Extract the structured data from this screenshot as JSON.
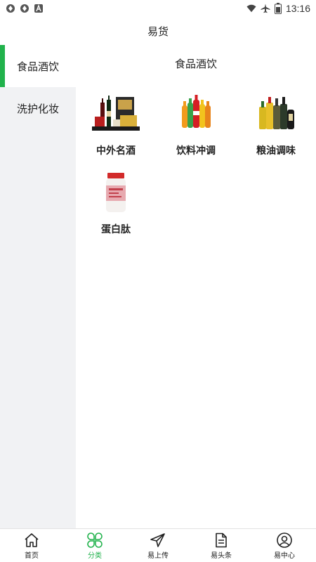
{
  "status_bar": {
    "time": "13:16",
    "left_icons": [
      "sync-icon",
      "sync-icon",
      "text-a-icon"
    ],
    "right_icons": [
      "wifi-icon",
      "airplane-icon",
      "battery-icon"
    ]
  },
  "header": {
    "title": "易货"
  },
  "sidebar": {
    "items": [
      {
        "label": "食品酒饮",
        "active": true
      },
      {
        "label": "洗护化妆",
        "active": false
      }
    ]
  },
  "main": {
    "section_title": "食品酒饮",
    "categories": [
      {
        "label": "中外名酒",
        "icon": "wine-products-image"
      },
      {
        "label": "饮料冲调",
        "icon": "beverage-bottles-image"
      },
      {
        "label": "粮油调味",
        "icon": "oil-bottles-image"
      },
      {
        "label": "蛋白肽",
        "icon": "protein-jar-image"
      }
    ]
  },
  "bottom_nav": {
    "items": [
      {
        "label": "首页",
        "icon": "home-icon",
        "active": false
      },
      {
        "label": "分类",
        "icon": "category-clover-icon",
        "active": true
      },
      {
        "label": "易上传",
        "icon": "paper-plane-icon",
        "active": false
      },
      {
        "label": "易头条",
        "icon": "document-icon",
        "active": false
      },
      {
        "label": "易中心",
        "icon": "user-circle-icon",
        "active": false
      }
    ]
  },
  "colors": {
    "accent": "#21b24c",
    "sidebar_bg": "#f1f2f4",
    "text": "#222222"
  }
}
